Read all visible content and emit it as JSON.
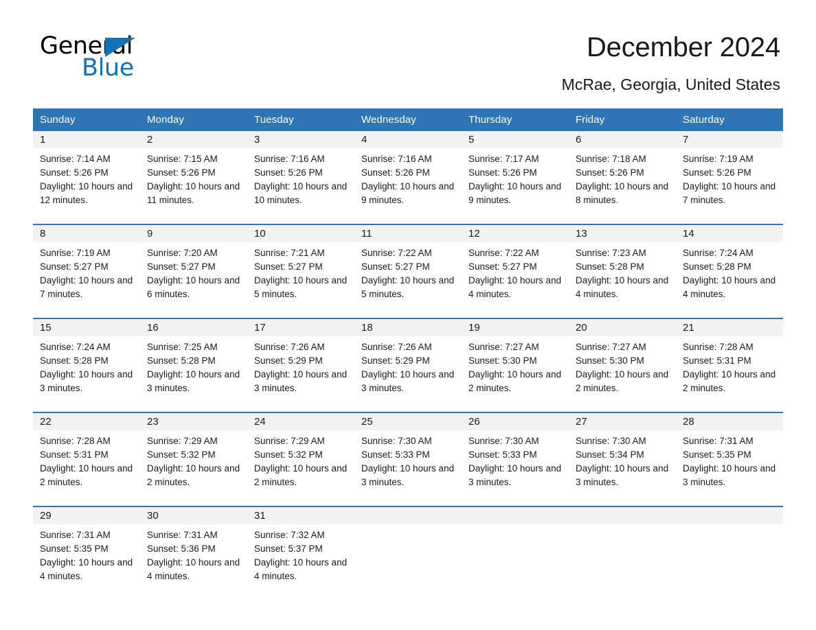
{
  "brand": {
    "name_part1": "General",
    "name_part2": "Blue"
  },
  "header": {
    "title": "December 2024",
    "location": "McRae, Georgia, United States"
  },
  "colors": {
    "header_blue": "#2e75b6",
    "brand_blue": "#1272b8",
    "daynum_band": "#f2f2f2"
  },
  "weekdays": [
    "Sunday",
    "Monday",
    "Tuesday",
    "Wednesday",
    "Thursday",
    "Friday",
    "Saturday"
  ],
  "weeks": [
    [
      {
        "day": "1",
        "sunrise": "Sunrise: 7:14 AM",
        "sunset": "Sunset: 5:26 PM",
        "daylight": "Daylight: 10 hours and 12 minutes."
      },
      {
        "day": "2",
        "sunrise": "Sunrise: 7:15 AM",
        "sunset": "Sunset: 5:26 PM",
        "daylight": "Daylight: 10 hours and 11 minutes."
      },
      {
        "day": "3",
        "sunrise": "Sunrise: 7:16 AM",
        "sunset": "Sunset: 5:26 PM",
        "daylight": "Daylight: 10 hours and 10 minutes."
      },
      {
        "day": "4",
        "sunrise": "Sunrise: 7:16 AM",
        "sunset": "Sunset: 5:26 PM",
        "daylight": "Daylight: 10 hours and 9 minutes."
      },
      {
        "day": "5",
        "sunrise": "Sunrise: 7:17 AM",
        "sunset": "Sunset: 5:26 PM",
        "daylight": "Daylight: 10 hours and 9 minutes."
      },
      {
        "day": "6",
        "sunrise": "Sunrise: 7:18 AM",
        "sunset": "Sunset: 5:26 PM",
        "daylight": "Daylight: 10 hours and 8 minutes."
      },
      {
        "day": "7",
        "sunrise": "Sunrise: 7:19 AM",
        "sunset": "Sunset: 5:26 PM",
        "daylight": "Daylight: 10 hours and 7 minutes."
      }
    ],
    [
      {
        "day": "8",
        "sunrise": "Sunrise: 7:19 AM",
        "sunset": "Sunset: 5:27 PM",
        "daylight": "Daylight: 10 hours and 7 minutes."
      },
      {
        "day": "9",
        "sunrise": "Sunrise: 7:20 AM",
        "sunset": "Sunset: 5:27 PM",
        "daylight": "Daylight: 10 hours and 6 minutes."
      },
      {
        "day": "10",
        "sunrise": "Sunrise: 7:21 AM",
        "sunset": "Sunset: 5:27 PM",
        "daylight": "Daylight: 10 hours and 5 minutes."
      },
      {
        "day": "11",
        "sunrise": "Sunrise: 7:22 AM",
        "sunset": "Sunset: 5:27 PM",
        "daylight": "Daylight: 10 hours and 5 minutes."
      },
      {
        "day": "12",
        "sunrise": "Sunrise: 7:22 AM",
        "sunset": "Sunset: 5:27 PM",
        "daylight": "Daylight: 10 hours and 4 minutes."
      },
      {
        "day": "13",
        "sunrise": "Sunrise: 7:23 AM",
        "sunset": "Sunset: 5:28 PM",
        "daylight": "Daylight: 10 hours and 4 minutes."
      },
      {
        "day": "14",
        "sunrise": "Sunrise: 7:24 AM",
        "sunset": "Sunset: 5:28 PM",
        "daylight": "Daylight: 10 hours and 4 minutes."
      }
    ],
    [
      {
        "day": "15",
        "sunrise": "Sunrise: 7:24 AM",
        "sunset": "Sunset: 5:28 PM",
        "daylight": "Daylight: 10 hours and 3 minutes."
      },
      {
        "day": "16",
        "sunrise": "Sunrise: 7:25 AM",
        "sunset": "Sunset: 5:28 PM",
        "daylight": "Daylight: 10 hours and 3 minutes."
      },
      {
        "day": "17",
        "sunrise": "Sunrise: 7:26 AM",
        "sunset": "Sunset: 5:29 PM",
        "daylight": "Daylight: 10 hours and 3 minutes."
      },
      {
        "day": "18",
        "sunrise": "Sunrise: 7:26 AM",
        "sunset": "Sunset: 5:29 PM",
        "daylight": "Daylight: 10 hours and 3 minutes."
      },
      {
        "day": "19",
        "sunrise": "Sunrise: 7:27 AM",
        "sunset": "Sunset: 5:30 PM",
        "daylight": "Daylight: 10 hours and 2 minutes."
      },
      {
        "day": "20",
        "sunrise": "Sunrise: 7:27 AM",
        "sunset": "Sunset: 5:30 PM",
        "daylight": "Daylight: 10 hours and 2 minutes."
      },
      {
        "day": "21",
        "sunrise": "Sunrise: 7:28 AM",
        "sunset": "Sunset: 5:31 PM",
        "daylight": "Daylight: 10 hours and 2 minutes."
      }
    ],
    [
      {
        "day": "22",
        "sunrise": "Sunrise: 7:28 AM",
        "sunset": "Sunset: 5:31 PM",
        "daylight": "Daylight: 10 hours and 2 minutes."
      },
      {
        "day": "23",
        "sunrise": "Sunrise: 7:29 AM",
        "sunset": "Sunset: 5:32 PM",
        "daylight": "Daylight: 10 hours and 2 minutes."
      },
      {
        "day": "24",
        "sunrise": "Sunrise: 7:29 AM",
        "sunset": "Sunset: 5:32 PM",
        "daylight": "Daylight: 10 hours and 2 minutes."
      },
      {
        "day": "25",
        "sunrise": "Sunrise: 7:30 AM",
        "sunset": "Sunset: 5:33 PM",
        "daylight": "Daylight: 10 hours and 3 minutes."
      },
      {
        "day": "26",
        "sunrise": "Sunrise: 7:30 AM",
        "sunset": "Sunset: 5:33 PM",
        "daylight": "Daylight: 10 hours and 3 minutes."
      },
      {
        "day": "27",
        "sunrise": "Sunrise: 7:30 AM",
        "sunset": "Sunset: 5:34 PM",
        "daylight": "Daylight: 10 hours and 3 minutes."
      },
      {
        "day": "28",
        "sunrise": "Sunrise: 7:31 AM",
        "sunset": "Sunset: 5:35 PM",
        "daylight": "Daylight: 10 hours and 3 minutes."
      }
    ],
    [
      {
        "day": "29",
        "sunrise": "Sunrise: 7:31 AM",
        "sunset": "Sunset: 5:35 PM",
        "daylight": "Daylight: 10 hours and 4 minutes."
      },
      {
        "day": "30",
        "sunrise": "Sunrise: 7:31 AM",
        "sunset": "Sunset: 5:36 PM",
        "daylight": "Daylight: 10 hours and 4 minutes."
      },
      {
        "day": "31",
        "sunrise": "Sunrise: 7:32 AM",
        "sunset": "Sunset: 5:37 PM",
        "daylight": "Daylight: 10 hours and 4 minutes."
      },
      {
        "day": "",
        "sunrise": "",
        "sunset": "",
        "daylight": ""
      },
      {
        "day": "",
        "sunrise": "",
        "sunset": "",
        "daylight": ""
      },
      {
        "day": "",
        "sunrise": "",
        "sunset": "",
        "daylight": ""
      },
      {
        "day": "",
        "sunrise": "",
        "sunset": "",
        "daylight": ""
      }
    ]
  ]
}
